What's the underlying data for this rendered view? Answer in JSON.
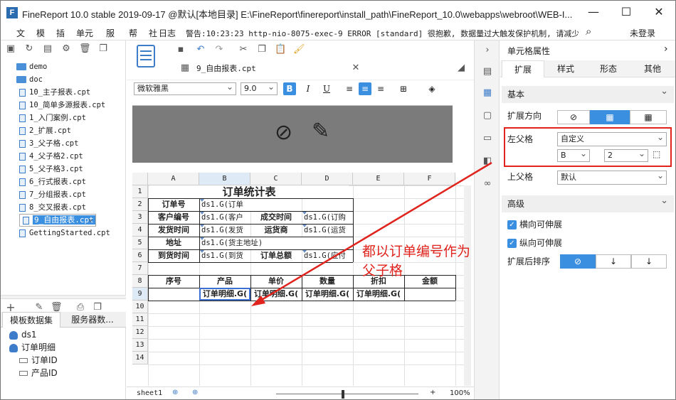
{
  "window": {
    "title": "FineReport 10.0 stable 2019-09-17 @默认[本地目录]    E:\\FineReport\\finereport\\install_path\\FineReport_10.0\\webapps\\webroot\\WEB-I...",
    "logo_letter": "F"
  },
  "menu": {
    "items": [
      "文",
      "模",
      "插",
      "单元",
      "服",
      "帮",
      "社",
      "日志"
    ],
    "log_text": "警告:10:23:23 http-nio-8075-exec-9 ERROR [standard] 很抱歉, 数据量过大触发保护机制, 请减少...",
    "login": "未登录"
  },
  "tree": {
    "items": [
      {
        "label": "demo",
        "type": "folder"
      },
      {
        "label": "doc",
        "type": "folder"
      },
      {
        "label": "10_主子报表.cpt",
        "type": "file"
      },
      {
        "label": "10_简单多源报表.cpt",
        "type": "file"
      },
      {
        "label": "1_入门案例.cpt",
        "type": "file"
      },
      {
        "label": "2_扩展.cpt",
        "type": "file"
      },
      {
        "label": "3_父子格.cpt",
        "type": "file"
      },
      {
        "label": "4_父子格2.cpt",
        "type": "file"
      },
      {
        "label": "5_父子格3.cpt",
        "type": "file"
      },
      {
        "label": "6_行式报表.cpt",
        "type": "file"
      },
      {
        "label": "7_分组报表.cpt",
        "type": "file"
      },
      {
        "label": "8_交叉报表.cpt",
        "type": "file"
      },
      {
        "label": "9_自由报表.cpt",
        "type": "file",
        "selected": true
      },
      {
        "label": "GettingStarted.cpt",
        "type": "file"
      }
    ]
  },
  "datasets": {
    "tabs": [
      "模板数据集",
      "服务器数..."
    ],
    "items": [
      {
        "label": "ds1",
        "kind": "db"
      },
      {
        "label": "订单明细",
        "kind": "db"
      },
      {
        "label": "订单ID",
        "kind": "field"
      },
      {
        "label": "产品ID",
        "kind": "field"
      }
    ]
  },
  "editor": {
    "file_tab": "9_自由报表.cpt",
    "font": "微软雅黑",
    "font_size": "9.0",
    "bold": "B",
    "italic": "I",
    "underline": "U"
  },
  "grid": {
    "columns": [
      "A",
      "B",
      "C",
      "D",
      "E",
      "F"
    ],
    "rows": [
      "1",
      "2",
      "3",
      "4",
      "5",
      "6",
      "7",
      "8",
      "9",
      "10",
      "11",
      "12",
      "13",
      "14"
    ],
    "title": "订单统计表",
    "r2": {
      "label": "订单号",
      "value": "ds1.G(订单"
    },
    "r3": {
      "label1": "客户编号",
      "value1": "ds1.G(客户",
      "label2": "成交时间",
      "value2": "ds1.G(订购"
    },
    "r4": {
      "label1": "发货时间",
      "value1": "ds1.G(发货",
      "label2": "运货商",
      "value2": "ds1.G(运货"
    },
    "r5": {
      "label": "地址",
      "value": "ds1.G(货主地址)"
    },
    "r6": {
      "label1": "到货时间",
      "value1": "ds1.G(到货",
      "label2": "订单总额",
      "value2": "ds1.G(应付"
    },
    "r8": [
      "序号",
      "产品",
      "单价",
      "数量",
      "折扣",
      "金额"
    ],
    "r9": [
      "订单明细.G(",
      "订单明细.G(",
      "订单明细.G(",
      "订单明细.G("
    ]
  },
  "sheet": {
    "name": "sheet1",
    "zoom": "100%"
  },
  "panel": {
    "title": "单元格属性",
    "tabs": [
      "扩展",
      "样式",
      "形态",
      "其他"
    ],
    "basic": "基本",
    "expand_dir_label": "扩展方向",
    "left_parent_label": "左父格",
    "left_parent_value": "自定义",
    "left_parent_col": "B",
    "left_parent_row": "2",
    "upper_parent_label": "上父格",
    "upper_parent_value": "默认",
    "advanced": "高级",
    "horiz_expand": "横向可伸展",
    "vert_expand": "纵向可伸展",
    "sort_label": "扩展后排序"
  },
  "annotation": {
    "line1": "都以订单编号作为",
    "line2": "父子格",
    "color": "#e0231c"
  }
}
